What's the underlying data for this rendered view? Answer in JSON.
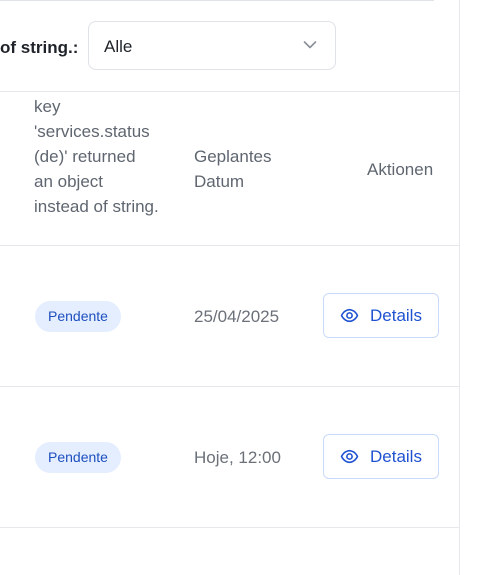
{
  "filter": {
    "label": "of string.:",
    "selected": "Alle",
    "chevron_icon": "chevron-down-icon"
  },
  "table": {
    "headers": {
      "status": "key 'services.status (de)' returned an object instead of string.",
      "date": "Geplantes Datum",
      "actions": "Aktionen"
    },
    "rows": [
      {
        "status": "Pendente",
        "date": "25/04/2025",
        "action_label": "Details",
        "action_icon": "eye-icon"
      },
      {
        "status": "Pendente",
        "date": "Hoje, 12:00",
        "action_label": "Details",
        "action_icon": "eye-icon"
      }
    ]
  },
  "colors": {
    "accent": "#1f52d1",
    "badge_bg": "#e4eeff",
    "border": "#e6e8ec"
  }
}
